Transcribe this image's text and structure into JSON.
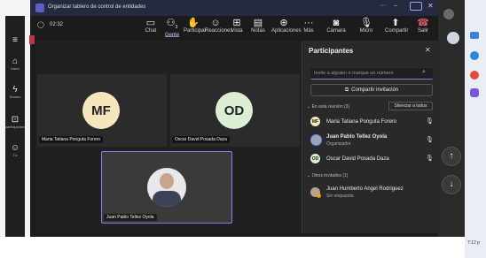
{
  "window": {
    "title": "Organizar tablero de control de entidades"
  },
  "call": {
    "timer": "02:32"
  },
  "toolbar": {
    "chat": "Chat",
    "people": "Gente",
    "people_count": "3",
    "raise": "Participar",
    "react": "Reacciones",
    "view": "Vista",
    "notes": "Notas",
    "apps": "Aplicaciones",
    "more": "Más",
    "camera": "Cámara",
    "mic": "Micro",
    "share": "Compartir",
    "leave": "Salir"
  },
  "left_rail": {
    "home": "Inicio",
    "shares": "Shares",
    "third": "participantes",
    "fourth": "Tú"
  },
  "tiles": [
    {
      "initials": "MF",
      "name": "Maria Tatiana Ponguta Forero",
      "color": "#f6e6be"
    },
    {
      "initials": "OD",
      "name": "Oscar David Posada Daza",
      "color": "#dcefd4"
    }
  ],
  "self_tile": {
    "name": "Juan Pablo Tellez Oyola"
  },
  "panel": {
    "title": "Participantes",
    "search_placeholder": "Invite a alguien o marque un número",
    "share_invite": "Compartir invitación",
    "in_meeting_label": "En esta reunión (3)",
    "mute_all": "Silenciar a todos",
    "others_label": "Otros invitados (1)",
    "participants": [
      {
        "initials": "MF",
        "name": "Maria Tatiana Ponguta Forero",
        "role": "",
        "color": "#f6e6be"
      },
      {
        "initials": "",
        "name": "Juan Pablo Tellez Oyola",
        "role": "Organizador",
        "color": "#9aa6b8"
      },
      {
        "initials": "OD",
        "name": "Oscar David Posada Daza",
        "role": "",
        "color": "#dcefd4"
      }
    ],
    "others": [
      {
        "name": "Juan Humberto Angel Rodriguez",
        "role": "Sin respuesta"
      }
    ]
  },
  "corner": {
    "time": "7:12 p"
  },
  "colors": {
    "accent": "#7b83eb",
    "leave": "#c4314b",
    "dark": "#1b1b1b"
  }
}
